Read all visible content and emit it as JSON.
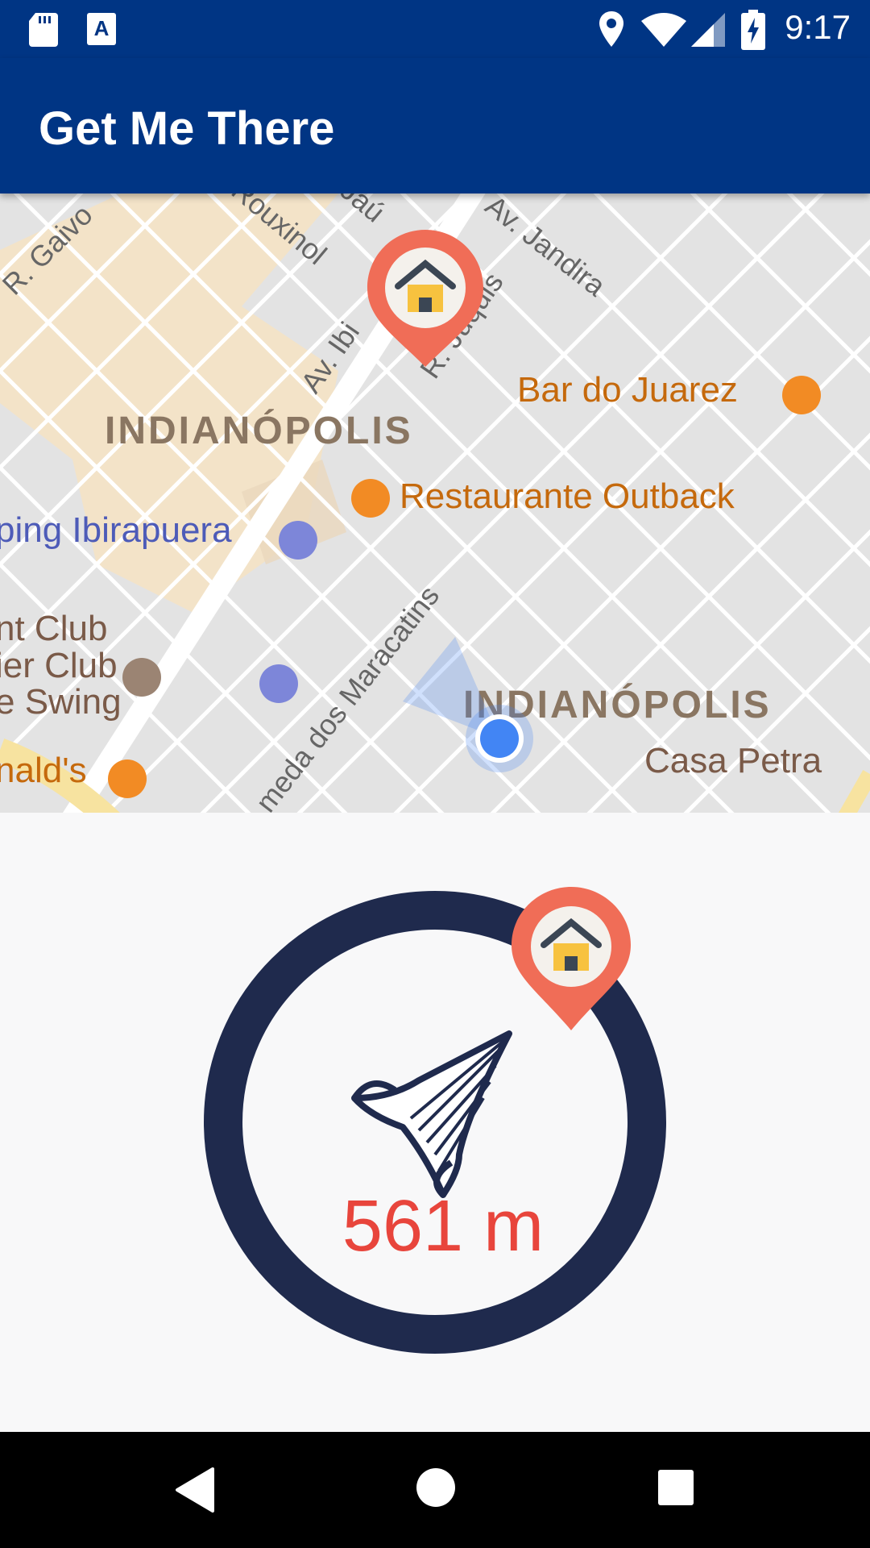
{
  "status_bar": {
    "time": "9:17",
    "icons": [
      "sd-card-icon",
      "a-box-icon",
      "location-icon",
      "wifi-icon",
      "signal-icon",
      "battery-charging-icon"
    ]
  },
  "app_bar": {
    "title": "Get Me There"
  },
  "map": {
    "streets": [
      "R. Gaivo",
      "Rouxinol",
      "Jaú",
      "Av. Ibi",
      "R. Juquis",
      "Av. Jandira",
      "meda dos Maracatins"
    ],
    "areas": [
      "INDIANÓPOLIS",
      "INDIANÓPOLIS"
    ],
    "places": [
      {
        "name": "Bar do Juarez",
        "icon": "bar-icon"
      },
      {
        "name": "Restaurante Outback",
        "icon": "restaurant-icon"
      },
      {
        "name": "ping Ibirapuera",
        "icon": "shopping-icon"
      },
      {
        "name": "nt Club",
        "icon": ""
      },
      {
        "name": "ier Club",
        "icon": "ring-icon"
      },
      {
        "name": "e Swing",
        "icon": ""
      },
      {
        "name": "nald's",
        "icon": "restaurant-icon"
      },
      {
        "name": "Casa Petra",
        "icon": ""
      }
    ],
    "colors": {
      "background": "#e3e3e3",
      "roads": "#ffffff",
      "park": "#f3e3c8",
      "marker": "#f06d57",
      "user_dot": "#4285f4"
    }
  },
  "compass": {
    "distance": "561 m",
    "ring_color": "#1f2a4d",
    "distance_color": "#e8453c",
    "destination_icon": "home-marker-icon",
    "arrow_icon": "arrow-needle-icon"
  },
  "nav_bar": {
    "buttons": [
      "back-button",
      "home-button",
      "recents-button"
    ]
  }
}
